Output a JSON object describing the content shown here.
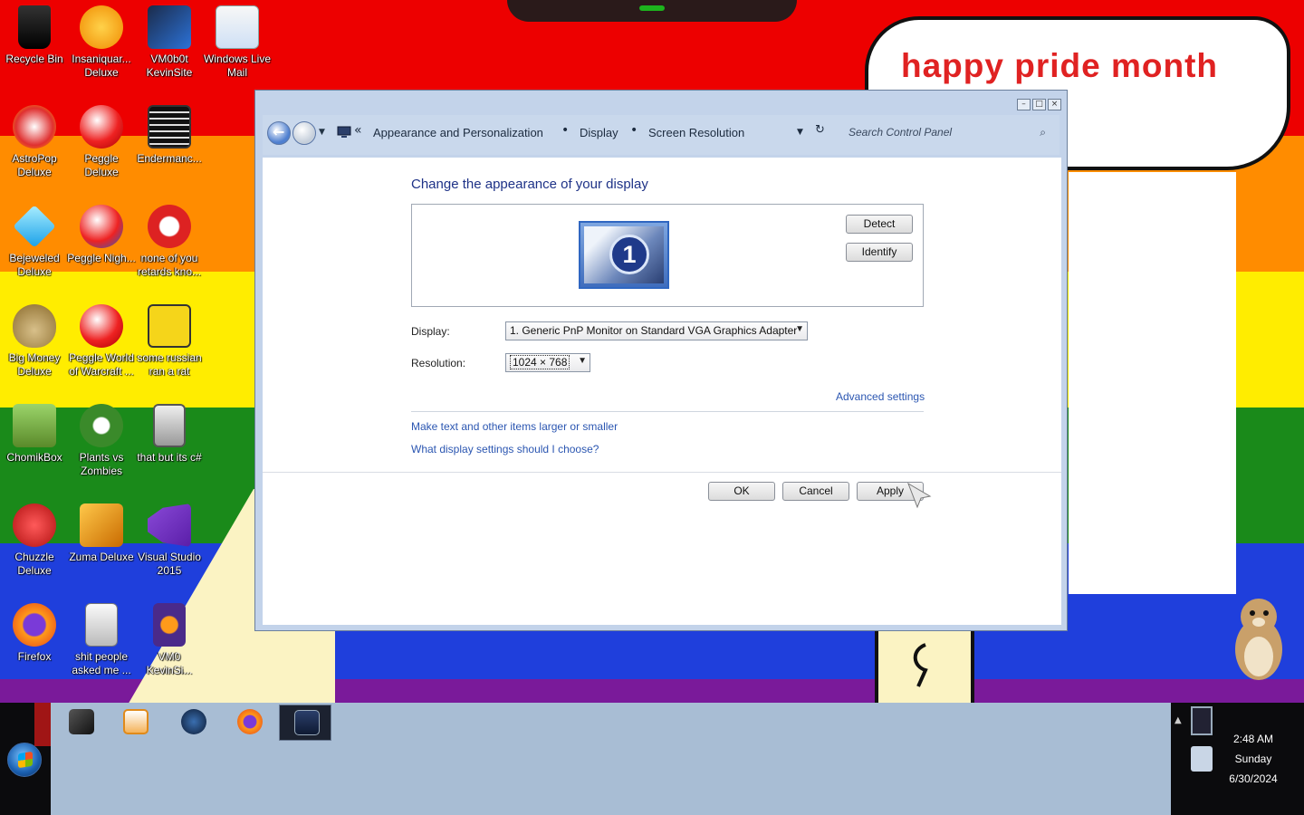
{
  "desktop": {
    "bubble_text": "happy pride month",
    "icons": [
      {
        "label": "Recycle Bin",
        "icon": "recycle-bin-icon"
      },
      {
        "label": "Insaniquar... Deluxe",
        "icon": "fish-icon"
      },
      {
        "label": "VM0b0t KevinSite",
        "icon": "monitor-icon"
      },
      {
        "label": "Windows Live Mail",
        "icon": "mail-icon"
      },
      {
        "label": "AstroPop Deluxe",
        "icon": "astropop-icon"
      },
      {
        "label": "Peggle Deluxe",
        "icon": "peggle-icon"
      },
      {
        "label": "Endermanc...",
        "icon": "terminal-icon"
      },
      {
        "label": "Bejeweled Deluxe",
        "icon": "gem-icon"
      },
      {
        "label": "Peggle Nigh...",
        "icon": "peggle-icon"
      },
      {
        "label": "none of you retards kno...",
        "icon": "dinosaur-icon"
      },
      {
        "label": "Big Money Deluxe",
        "icon": "money-bag-icon"
      },
      {
        "label": "Peggle World of Warcraft ...",
        "icon": "peggle-icon"
      },
      {
        "label": "some russian ran a rat",
        "icon": "de-icon"
      },
      {
        "label": "ChomikBox",
        "icon": "hamster-icon"
      },
      {
        "label": "Plants vs Zombies",
        "icon": "plant-icon"
      },
      {
        "label": "that but its c#",
        "icon": "windows-stack-icon"
      },
      {
        "label": "Chuzzle Deluxe",
        "icon": "chuzzle-icon"
      },
      {
        "label": "Zuma Deluxe",
        "icon": "zuma-icon"
      },
      {
        "label": "Visual Studio 2015",
        "icon": "visual-studio-icon"
      },
      {
        "label": "Firefox",
        "icon": "firefox-icon"
      },
      {
        "label": "shit people asked me ...",
        "icon": "document-icon"
      },
      {
        "label": "VM0 KevinSi...",
        "icon": "firefox-icon"
      }
    ]
  },
  "window": {
    "breadcrumb": [
      "Appearance and Personalization",
      "Display",
      "Screen Resolution"
    ],
    "search_placeholder": "Search Control Panel",
    "heading": "Change the appearance of your display",
    "monitor_number": "1",
    "detect_label": "Detect",
    "identify_label": "Identify",
    "display_label": "Display:",
    "display_value": "1. Generic PnP Monitor on Standard VGA Graphics Adapter",
    "resolution_label": "Resolution:",
    "resolution_value": "1024 × 768",
    "advanced_link": "Advanced settings",
    "link_text_size": "Make text and other items larger or smaller",
    "link_help": "What display settings should I choose?",
    "ok_label": "OK",
    "cancel_label": "Cancel",
    "apply_label": "Apply"
  },
  "taskbar": {
    "time": "2:48 AM",
    "day": "Sunday",
    "date": "6/30/2024"
  },
  "colors": {
    "accent": "#1e3287",
    "link": "#2b56b1"
  }
}
